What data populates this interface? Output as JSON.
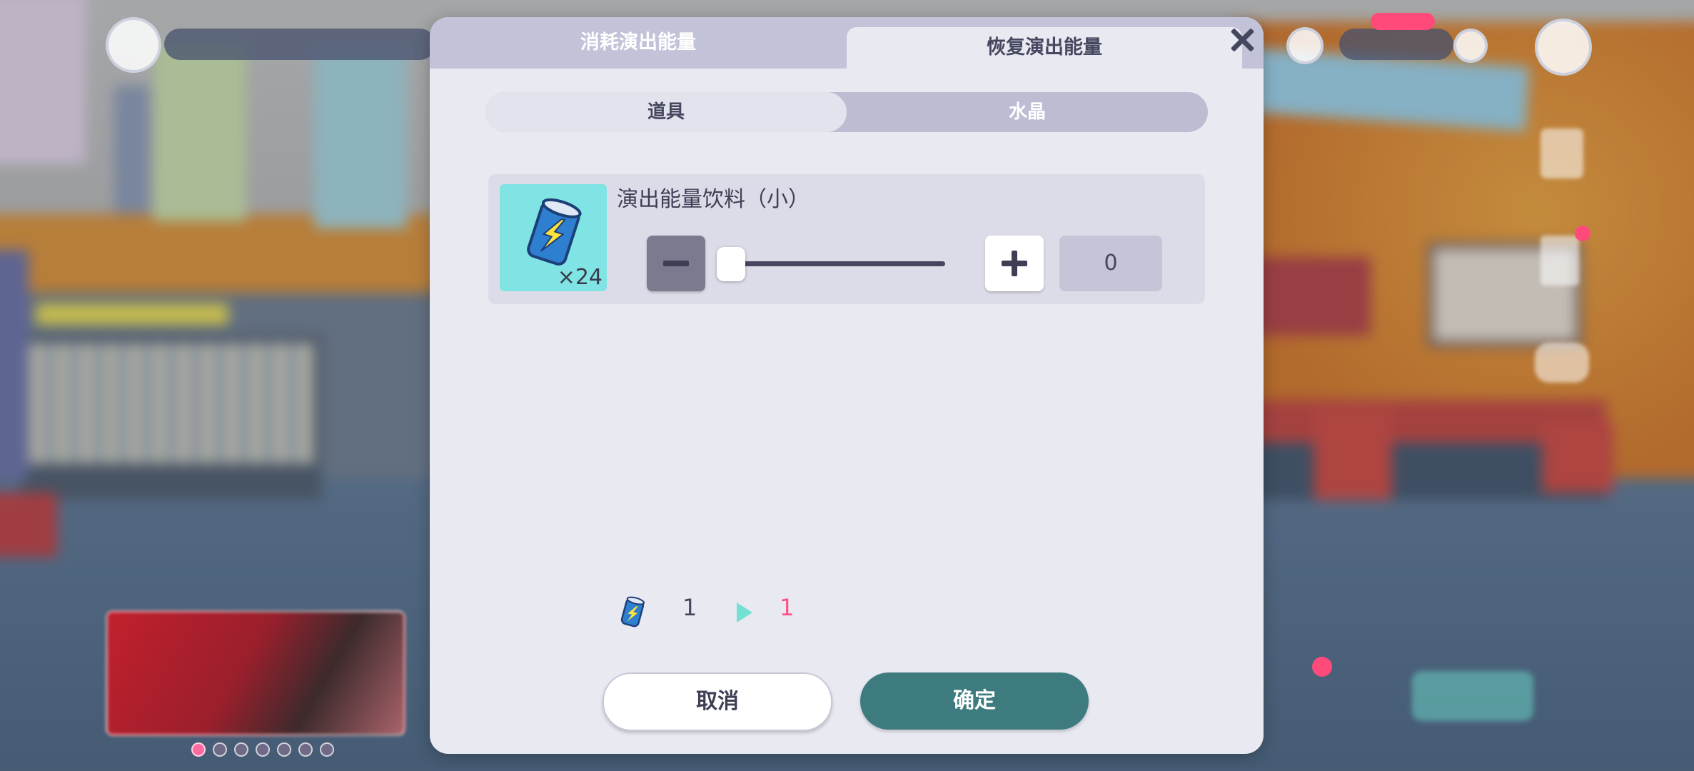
{
  "tabs": {
    "consume_label": "消耗演出能量",
    "recover_label": "恢复演出能量"
  },
  "segment": {
    "tools_label": "道具",
    "crystal_label": "水晶"
  },
  "item": {
    "name": "演出能量饮料（小）",
    "count": "×24",
    "icon": "energy-drink-can-icon",
    "quantity": "0"
  },
  "preview": {
    "from": "1",
    "to": "1"
  },
  "buttons": {
    "cancel": "取消",
    "confirm": "确定"
  },
  "colors": {
    "accent_teal": "#3e7b7e",
    "highlight_pink": "#ff4d87",
    "arrow_cyan": "#72e0d2",
    "item_bg": "#7fe4e3"
  }
}
